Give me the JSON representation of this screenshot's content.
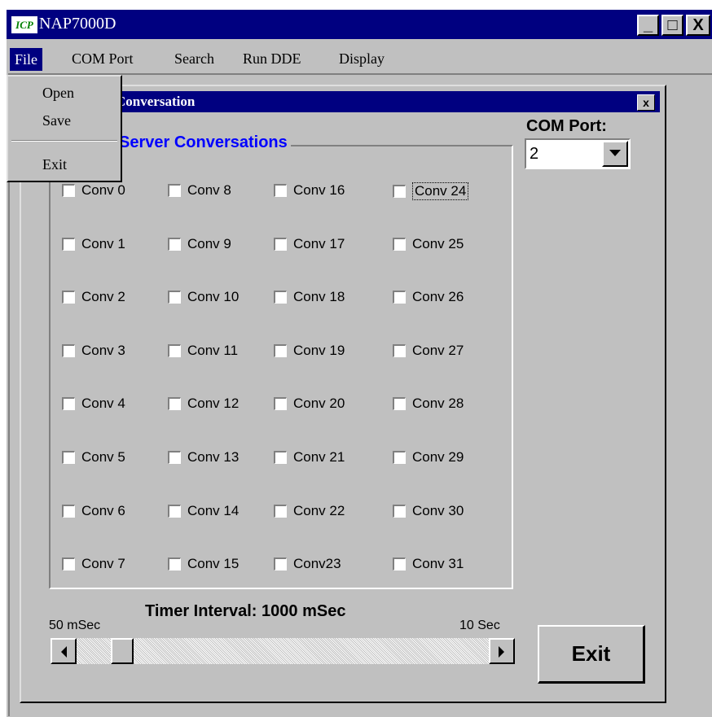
{
  "window": {
    "title": "NAP7000D",
    "icon_text": "ICP",
    "minimize": "_",
    "maximize": "□",
    "close": "X"
  },
  "menubar": {
    "items": [
      "File",
      "COM Port",
      "Search",
      "Run DDE",
      "Display"
    ]
  },
  "file_menu": {
    "items": [
      "Open",
      "Save",
      "Exit"
    ]
  },
  "child_window": {
    "title": "Conversation",
    "close": "x"
  },
  "group": {
    "label": "Server Conversations"
  },
  "conversations": [
    [
      "Conv 0",
      "Conv 8",
      "Conv 16",
      "Conv 24"
    ],
    [
      "Conv 1",
      "Conv 9",
      "Conv 17",
      "Conv 25"
    ],
    [
      "Conv 2",
      "Conv 10",
      "Conv 18",
      "Conv 26"
    ],
    [
      "Conv 3",
      "Conv 11",
      "Conv 19",
      "Conv 27"
    ],
    [
      "Conv 4",
      "Conv 12",
      "Conv 20",
      "Conv 28"
    ],
    [
      "Conv 5",
      "Conv 13",
      "Conv 21",
      "Conv 29"
    ],
    [
      "Conv 6",
      "Conv 14",
      "Conv 22",
      "Conv 30"
    ],
    [
      "Conv 7",
      "Conv 15",
      "Conv23",
      "Conv 31"
    ]
  ],
  "com_port": {
    "label": "COM Port:",
    "value": "2"
  },
  "timer": {
    "label": "Timer Interval: 1000 mSec",
    "min_label": "50 mSec",
    "max_label": "10 Sec"
  },
  "exit_button": {
    "label": "Exit"
  },
  "colors": {
    "titlebar": "#000080",
    "face": "#c0c0c0",
    "group_label": "#0000ff"
  }
}
